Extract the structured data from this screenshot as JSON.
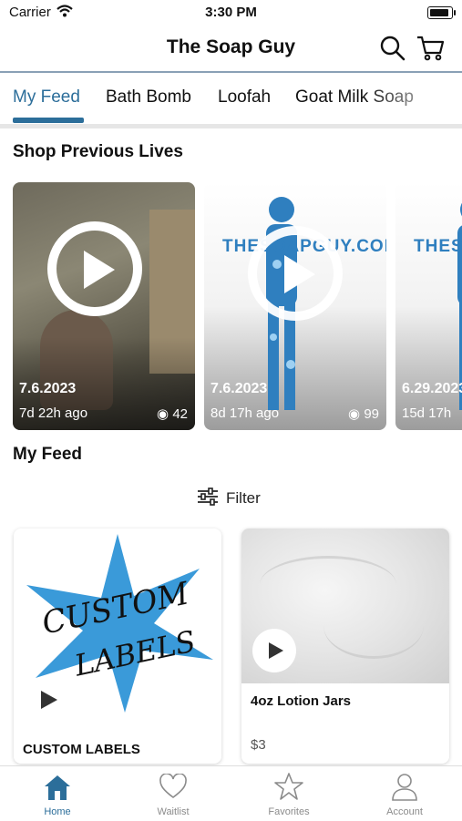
{
  "status_bar": {
    "carrier": "Carrier",
    "time": "3:30 PM"
  },
  "header": {
    "title": "The Soap Guy",
    "search_icon": "search-icon",
    "cart_icon": "cart-icon"
  },
  "tabs": [
    {
      "label": "My Feed",
      "active": true
    },
    {
      "label": "Bath Bomb"
    },
    {
      "label": "Loofah"
    },
    {
      "label": "Goat Milk Soap"
    }
  ],
  "previous_lives": {
    "title": "Shop Previous Lives",
    "items": [
      {
        "date": "7.6.2023",
        "ago": "7d 22h ago",
        "views": "42"
      },
      {
        "date": "7.6.2023",
        "ago": "8d 17h ago",
        "views": "99",
        "logo_text": "THESOAPGUY.COM"
      },
      {
        "date": "6.29.2023",
        "ago": "15d 17h",
        "views": "",
        "logo_text": "THESOAPGUY.COM"
      }
    ]
  },
  "feed": {
    "title": "My Feed",
    "filter_label": "Filter"
  },
  "products": [
    {
      "name": "CUSTOM LABELS",
      "image_text_1": "CUSTOM",
      "image_text_2": "LABELS",
      "price": ""
    },
    {
      "name": "4oz Lotion Jars",
      "price": "$3"
    }
  ],
  "bottom_nav": [
    {
      "label": "Home",
      "icon": "home-icon",
      "active": true
    },
    {
      "label": "Waitlist",
      "icon": "heart-icon"
    },
    {
      "label": "Favorites",
      "icon": "star-icon"
    },
    {
      "label": "Account",
      "icon": "account-icon"
    }
  ],
  "colors": {
    "accent": "#2c6e9a",
    "star": "#3a9ad9",
    "header_border": "#8aa0b6"
  }
}
